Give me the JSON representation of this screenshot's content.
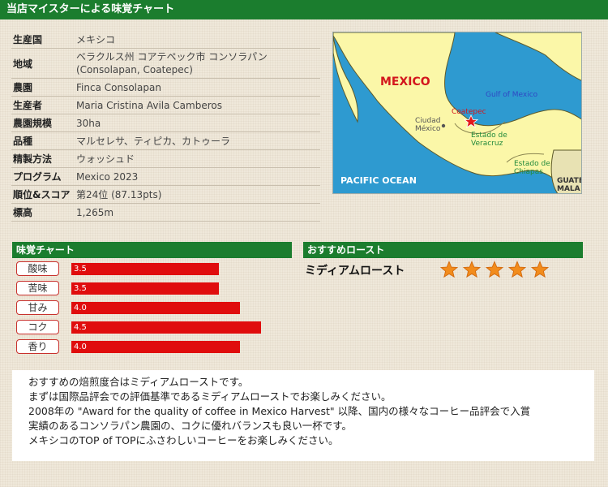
{
  "header": {
    "title": "当店マイスターによる味覚チャート"
  },
  "info": [
    {
      "label": "生産国",
      "value": "メキシコ"
    },
    {
      "label": "地域",
      "value": "ベラクルス州 コアテペック市 コンソラパン\n(Consolapan, Coatepec)"
    },
    {
      "label": "農園",
      "value": "Finca Consolapan"
    },
    {
      "label": "生産者",
      "value": "Maria Cristina Avila Camberos"
    },
    {
      "label": "農園規模",
      "value": "30ha"
    },
    {
      "label": "品種",
      "value": "マルセレサ、ティピカ、カトゥーラ"
    },
    {
      "label": "精製方法",
      "value": "ウォッシュド"
    },
    {
      "label": "プログラム",
      "value": "Mexico 2023"
    },
    {
      "label": "順位&スコア",
      "value": "第24位 (87.13pts)"
    },
    {
      "label": "標高",
      "value": "1,265m"
    }
  ],
  "map": {
    "country": "MEXICO",
    "gulf": "Gulf of Mexico",
    "ocean": "PACIFIC OCEAN",
    "city": "Coatepec",
    "capital": "Ciudad\nMéxico",
    "veracruz": "Estado de\nVeracruz",
    "chiapas": "Estado de\nChiapas",
    "guatemala": "GUATE\nMALA"
  },
  "taste": {
    "title": "味覚チャート",
    "max": 5,
    "items": [
      {
        "label": "酸味",
        "value": 3.5,
        "display": "3.5"
      },
      {
        "label": "苦味",
        "value": 3.5,
        "display": "3.5"
      },
      {
        "label": "甘み",
        "value": 4.0,
        "display": "4.0"
      },
      {
        "label": "コク",
        "value": 4.5,
        "display": "4.5"
      },
      {
        "label": "香り",
        "value": 4.0,
        "display": "4.0"
      }
    ]
  },
  "roast": {
    "title": "おすすめロースト",
    "name": "ミディアムロースト",
    "rating": 5,
    "max_rating": 5
  },
  "description": [
    "おすすめの焙煎度合はミディアムローストです。",
    "まずは国際品評会での評価基準であるミディアムローストでお楽しみください。",
    "2008年の \"Award for the quality of coffee in Mexico Harvest\" 以降、国内の様々なコーヒー品評会で入賞",
    "実績のあるコンソラパン農園の、コクに優れバランスも良い一杯です。",
    "メキシコのTOP of TOPにふさわしいコーヒーをお楽しみください。"
  ],
  "colors": {
    "green": "#1b7d2e",
    "bar": "#e00d0d",
    "star": "#f28c1c"
  }
}
